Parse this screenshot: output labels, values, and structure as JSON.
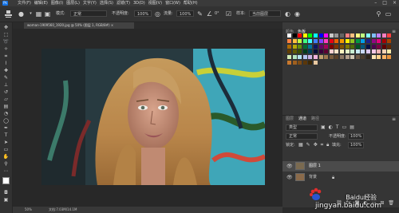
{
  "menubar": {
    "items": [
      "文件(F)",
      "编辑(E)",
      "图像(I)",
      "图层(L)",
      "文字(Y)",
      "选择(S)",
      "滤镜(T)",
      "3D(D)",
      "视图(V)",
      "窗口(W)",
      "帮助(H)"
    ],
    "window_controls": [
      "–",
      "□",
      "×"
    ]
  },
  "optbar": {
    "mode_label": "模式:",
    "mode_value": "正常",
    "opacity_label": "不透明度:",
    "opacity_value": "100%",
    "flow_label": "流量:",
    "flow_value": "100%",
    "sample_label": "样本:",
    "sample_value": "当前图层",
    "angle_value": "0°"
  },
  "document": {
    "tab_title": "woman-1909560_1920.jpg @ 50% (图层 1, RGB/8#) ×",
    "zoom": "50%",
    "doc_info": "文档:7.03M/14.1M"
  },
  "swatches_panel": {
    "tabs": [
      "颜色",
      "色板"
    ],
    "active_tab": "色板",
    "colors": [
      "#ffffff",
      "#000000",
      "#ff0000",
      "#ffff00",
      "#00ff00",
      "#00ffff",
      "#0000ff",
      "#ff00ff",
      "#c8c8c8",
      "#969696",
      "#646464",
      "#ff7f7f",
      "#ffbf7f",
      "#ffff7f",
      "#bfff7f",
      "#7fffff",
      "#7fbfff",
      "#bf7fff",
      "#ff7fbf",
      "#ff4040",
      "#ff8040",
      "#ffc040",
      "#c0ff40",
      "#40ff80",
      "#40ffff",
      "#4080ff",
      "#8040ff",
      "#ff40c0",
      "#e60012",
      "#eb6100",
      "#f39800",
      "#fff100",
      "#8fc31f",
      "#009944",
      "#00a0e9",
      "#1d2088",
      "#920783",
      "#e4007f",
      "#a40000",
      "#a84200",
      "#ad6a00",
      "#b7aa00",
      "#638c0b",
      "#006c31",
      "#00719c",
      "#0d1561",
      "#660366",
      "#a1005a",
      "#7f0000",
      "#7f3300",
      "#7f5100",
      "#7f7700",
      "#4d6a06",
      "#005224",
      "#005679",
      "#06114a",
      "#4c0050",
      "#7b0043",
      "#5f0000",
      "#5f2600",
      "#5f3d00",
      "#5f5900",
      "#394f04",
      "#003d1b",
      "#00405a",
      "#040d37",
      "#39003c",
      "#5c0032",
      "#ffd0d0",
      "#ffe3c8",
      "#fff3c0",
      "#e6f5c8",
      "#c8f0d2",
      "#c8ecf5",
      "#c8d7f5",
      "#dcc8f0",
      "#f5c8e6",
      "#f0b4b4",
      "#f5d2b4",
      "#faeaa8",
      "#d2ebb4",
      "#b4e6c0",
      "#b4e2f0",
      "#b4c6f0",
      "#ccb4e6",
      "#f0b4dc",
      "#bfa06e",
      "#a07850",
      "#785a3c",
      "#5a4028",
      "#8c7864",
      "#b4a08c",
      "#d2c8b4",
      "#6e5a46",
      "#4b3c2d",
      "#2d2419",
      "#ffe5b4",
      "#ffd28c",
      "#ffb464",
      "#e6913c",
      "#c8782d",
      "#a0601e",
      "#7d4b14",
      "#5a370a",
      "#3c2805",
      "#e8c8a0"
    ]
  },
  "layers_panel": {
    "tabs": [
      "图层",
      "通道",
      "路径"
    ],
    "active_tab": "通道",
    "kind_label": "类型",
    "blend_mode": "正常",
    "opacity_label": "不透明度:",
    "opacity_value": "100%",
    "lock_label": "锁定:",
    "fill_label": "填充:",
    "fill_value": "100%",
    "layers": [
      {
        "name": "图层 1",
        "selected": true
      },
      {
        "name": "背景",
        "selected": false
      }
    ]
  },
  "watermark": {
    "brand": "Baidu经验",
    "url": "jingyan.baidu.com"
  },
  "colors": {
    "foreground": "#ffffff",
    "background": "#000000",
    "accent": "#1473e6"
  }
}
